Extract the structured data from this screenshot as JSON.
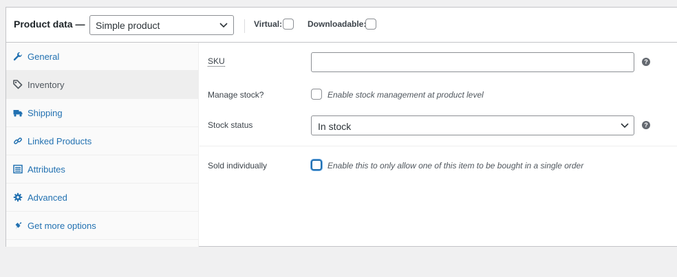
{
  "header": {
    "title": "Product data —",
    "product_type": "Simple product",
    "virtual_label": "Virtual:",
    "downloadable_label": "Downloadable:"
  },
  "tabs": [
    {
      "label": "General",
      "icon": "wrench-icon",
      "active": false
    },
    {
      "label": "Inventory",
      "icon": "tag-icon",
      "active": true
    },
    {
      "label": "Shipping",
      "icon": "truck-icon",
      "active": false
    },
    {
      "label": "Linked Products",
      "icon": "link-icon",
      "active": false
    },
    {
      "label": "Attributes",
      "icon": "list-icon",
      "active": false
    },
    {
      "label": "Advanced",
      "icon": "gear-icon",
      "active": false
    },
    {
      "label": "Get more options",
      "icon": "plugin-icon",
      "active": false
    }
  ],
  "inventory": {
    "sku_label": "SKU",
    "sku_value": "",
    "manage_stock_label": "Manage stock?",
    "manage_stock_desc": "Enable stock management at product level",
    "stock_status_label": "Stock status",
    "stock_status_value": "In stock",
    "sold_individually_label": "Sold individually",
    "sold_individually_desc": "Enable this to only allow one of this item to be bought in a single order",
    "help_glyph": "?"
  },
  "colors": {
    "link": "#2271b1",
    "active_tab_bg": "#eeeeee",
    "border": "#c3c4c7"
  }
}
